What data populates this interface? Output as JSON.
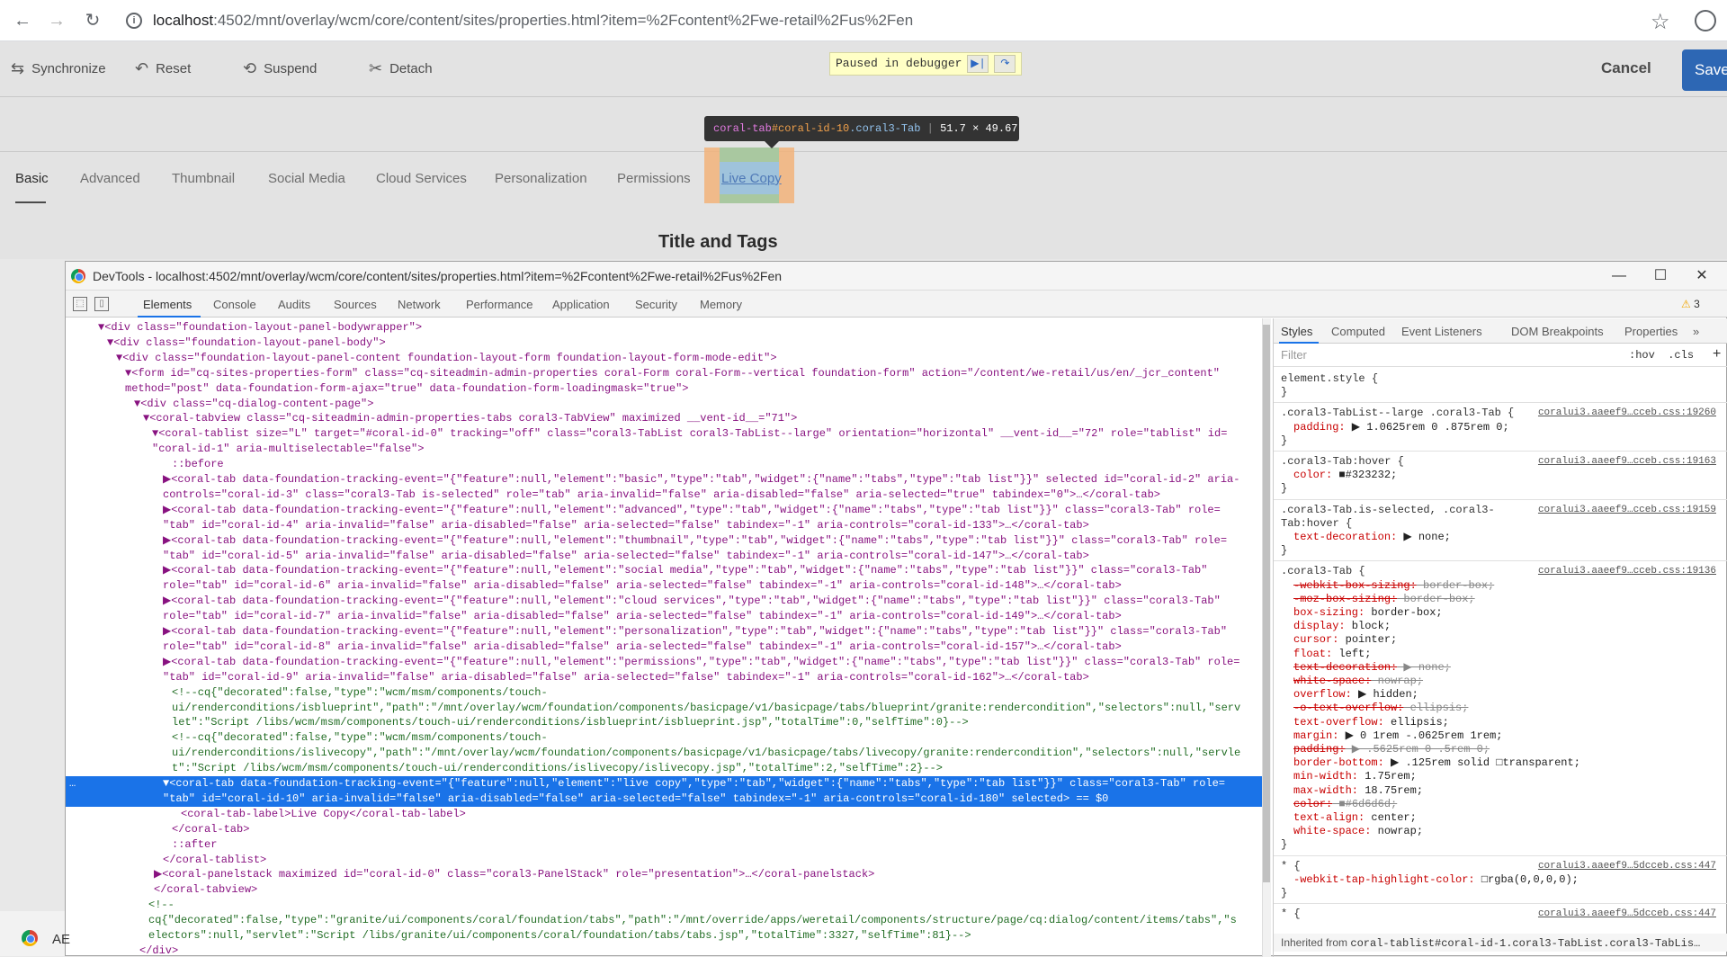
{
  "browser": {
    "url_host": "localhost",
    "url_rest": ":4502/mnt/overlay/wcm/core/content/sites/properties.html?item=%2Fcontent%2Fwe-retail%2Fus%2Fen",
    "icons": [
      "back-arrow-icon",
      "forward-arrow-icon",
      "reload-icon",
      "info-icon",
      "star-icon",
      "profile-icon"
    ]
  },
  "toolbar": {
    "synchronize": "Synchronize",
    "reset": "Reset",
    "suspend": "Suspend",
    "detach": "Detach",
    "paused": "Paused in debugger",
    "cancel": "Cancel",
    "save": "Save"
  },
  "tabs": [
    "Basic",
    "Advanced",
    "Thumbnail",
    "Social Media",
    "Cloud Services",
    "Personalization",
    "Permissions",
    "Live Copy"
  ],
  "tooltip": {
    "tag": "coral-tab",
    "id": "#coral-id-10",
    "cls": ".coral3-Tab",
    "size": "51.7 × 49.67"
  },
  "section_title": "Title and Tags",
  "devtools": {
    "title": "DevTools - localhost:4502/mnt/overlay/wcm/core/content/sites/properties.html?item=%2Fcontent%2Fwe-retail%2Fus%2Fen",
    "tabs": [
      "Elements",
      "Console",
      "Audits",
      "Sources",
      "Network",
      "Performance",
      "Application",
      "Security",
      "Memory"
    ],
    "warnings": "3",
    "window_controls": [
      "minimize",
      "maximize",
      "close"
    ]
  },
  "elements_lines": [
    "▼<div class=\"foundation-layout-panel-bodywrapper\">",
    "▼<div class=\"foundation-layout-panel-body\">",
    "▼<div class=\"foundation-layout-panel-content foundation-layout-form foundation-layout-form-mode-edit\">",
    "▼<form id=\"cq-sites-properties-form\" class=\"cq-siteadmin-admin-properties coral-Form coral-Form--vertical foundation-form\" action=\"/content/we-retail/us/en/_jcr_content\"",
    "method=\"post\" data-foundation-form-ajax=\"true\" data-foundation-form-loadingmask=\"true\">",
    "▼<div class=\"cq-dialog-content-page\">",
    "▼<coral-tabview class=\"cq-siteadmin-admin-properties-tabs coral3-TabView\" maximized __vent-id__=\"71\">",
    "▼<coral-tablist size=\"L\" target=\"#coral-id-0\" tracking=\"off\" class=\"coral3-TabList coral3-TabList--large\" orientation=\"horizontal\" __vent-id__=\"72\" role=\"tablist\" id=",
    "\"coral-id-1\" aria-multiselectable=\"false\">",
    "::before",
    "▶<coral-tab data-foundation-tracking-event=\"{\"feature\":null,\"element\":\"basic\",\"type\":\"tab\",\"widget\":{\"name\":\"tabs\",\"type\":\"tab list\"}}\" selected id=\"coral-id-2\" aria-",
    "controls=\"coral-id-3\" class=\"coral3-Tab is-selected\" role=\"tab\" aria-invalid=\"false\" aria-disabled=\"false\" aria-selected=\"true\" tabindex=\"0\">…</coral-tab>",
    "▶<coral-tab data-foundation-tracking-event=\"{\"feature\":null,\"element\":\"advanced\",\"type\":\"tab\",\"widget\":{\"name\":\"tabs\",\"type\":\"tab list\"}}\" class=\"coral3-Tab\" role=",
    "\"tab\" id=\"coral-id-4\" aria-invalid=\"false\" aria-disabled=\"false\" aria-selected=\"false\" tabindex=\"-1\" aria-controls=\"coral-id-133\">…</coral-tab>",
    "▶<coral-tab data-foundation-tracking-event=\"{\"feature\":null,\"element\":\"thumbnail\",\"type\":\"tab\",\"widget\":{\"name\":\"tabs\",\"type\":\"tab list\"}}\" class=\"coral3-Tab\" role=",
    "\"tab\" id=\"coral-id-5\" aria-invalid=\"false\" aria-disabled=\"false\" aria-selected=\"false\" tabindex=\"-1\" aria-controls=\"coral-id-147\">…</coral-tab>",
    "▶<coral-tab data-foundation-tracking-event=\"{\"feature\":null,\"element\":\"social media\",\"type\":\"tab\",\"widget\":{\"name\":\"tabs\",\"type\":\"tab list\"}}\" class=\"coral3-Tab\"",
    "role=\"tab\" id=\"coral-id-6\" aria-invalid=\"false\" aria-disabled=\"false\" aria-selected=\"false\" tabindex=\"-1\" aria-controls=\"coral-id-148\">…</coral-tab>",
    "▶<coral-tab data-foundation-tracking-event=\"{\"feature\":null,\"element\":\"cloud services\",\"type\":\"tab\",\"widget\":{\"name\":\"tabs\",\"type\":\"tab list\"}}\" class=\"coral3-Tab\"",
    "role=\"tab\" id=\"coral-id-7\" aria-invalid=\"false\" aria-disabled=\"false\" aria-selected=\"false\" tabindex=\"-1\" aria-controls=\"coral-id-149\">…</coral-tab>",
    "▶<coral-tab data-foundation-tracking-event=\"{\"feature\":null,\"element\":\"personalization\",\"type\":\"tab\",\"widget\":{\"name\":\"tabs\",\"type\":\"tab list\"}}\" class=\"coral3-Tab\"",
    "role=\"tab\" id=\"coral-id-8\" aria-invalid=\"false\" aria-disabled=\"false\" aria-selected=\"false\" tabindex=\"-1\" aria-controls=\"coral-id-157\">…</coral-tab>",
    "▶<coral-tab data-foundation-tracking-event=\"{\"feature\":null,\"element\":\"permissions\",\"type\":\"tab\",\"widget\":{\"name\":\"tabs\",\"type\":\"tab list\"}}\" class=\"coral3-Tab\" role=",
    "\"tab\" id=\"coral-id-9\" aria-invalid=\"false\" aria-disabled=\"false\" aria-selected=\"false\" tabindex=\"-1\" aria-controls=\"coral-id-162\">…</coral-tab>",
    "<!--cq{\"decorated\":false,\"type\":\"wcm/msm/components/touch-",
    "ui/renderconditions/isblueprint\",\"path\":\"/mnt/overlay/wcm/foundation/components/basicpage/v1/basicpage/tabs/blueprint/granite:rendercondition\",\"selectors\":null,\"serv",
    "let\":\"Script /libs/wcm/msm/components/touch-ui/renderconditions/isblueprint/isblueprint.jsp\",\"totalTime\":0,\"selfTime\":0}-->",
    "<!--cq{\"decorated\":false,\"type\":\"wcm/msm/components/touch-",
    "ui/renderconditions/islivecopy\",\"path\":\"/mnt/overlay/wcm/foundation/components/basicpage/v1/basicpage/tabs/livecopy/granite:rendercondition\",\"selectors\":null,\"servle",
    "t\":\"Script /libs/wcm/msm/components/touch-ui/renderconditions/islivecopy/islivecopy.jsp\",\"totalTime\":2,\"selfTime\":2}-->",
    "▼<coral-tab data-foundation-tracking-event=\"{\"feature\":null,\"element\":\"live copy\",\"type\":\"tab\",\"widget\":{\"name\":\"tabs\",\"type\":\"tab list\"}}\" class=\"coral3-Tab\" role=",
    "\"tab\" id=\"coral-id-10\" aria-invalid=\"false\" aria-disabled=\"false\" aria-selected=\"false\" tabindex=\"-1\" aria-controls=\"coral-id-180\" selected> == $0",
    "<coral-tab-label>Live Copy</coral-tab-label>",
    "</coral-tab>",
    "::after",
    "</coral-tablist>",
    "▶<coral-panelstack maximized id=\"coral-id-0\" class=\"coral3-PanelStack\" role=\"presentation\">…</coral-panelstack>",
    "</coral-tabview>",
    "<!--",
    "cq{\"decorated\":false,\"type\":\"granite/ui/components/coral/foundation/tabs\",\"path\":\"/mnt/override/apps/weretail/components/structure/page/cq:dialog/content/items/tabs\",\"s",
    "electors\":null,\"servlet\":\"Script /libs/granite/ui/components/coral/foundation/tabs/tabs.jsp\",\"totalTime\":3327,\"selfTime\":81}-->",
    "</div>"
  ],
  "styles": {
    "tabs": [
      "Styles",
      "Computed",
      "Event Listeners",
      "DOM Breakpoints",
      "Properties"
    ],
    "filter_placeholder": "Filter",
    "hov": ":hov",
    "cls": ".cls",
    "inherited_label": "Inherited from",
    "inherited_node": "coral-tablist#coral-id-1.coral3-TabList.coral3-TabLis…"
  },
  "styles_lines": [
    {
      "t": "element.style {",
      "k": "sel"
    },
    {
      "t": "}",
      "k": "sel"
    },
    {
      "t": ".coral3-TabList--large .coral3-Tab {",
      "k": "sel",
      "src": "coralui3.aaeef9…cceb.css:19260"
    },
    {
      "t": "padding: ▶ 1.0625rem 0 .875rem 0;",
      "k": "prop"
    },
    {
      "t": "}",
      "k": "sel"
    },
    {
      "t": ".coral3-Tab:hover {",
      "k": "sel",
      "src": "coralui3.aaeef9…cceb.css:19163"
    },
    {
      "t": "color: ■#323232;",
      "k": "prop"
    },
    {
      "t": "}",
      "k": "sel"
    },
    {
      "t": ".coral3-Tab.is-selected, .coral3-",
      "k": "sel",
      "src": "coralui3.aaeef9…cceb.css:19159"
    },
    {
      "t": "Tab:hover {",
      "k": "sel"
    },
    {
      "t": "text-decoration: ▶ none;",
      "k": "prop"
    },
    {
      "t": "}",
      "k": "sel"
    },
    {
      "t": ".coral3-Tab {",
      "k": "sel",
      "src": "coralui3.aaeef9…cceb.css:19136"
    },
    {
      "t": "-webkit-box-sizing: border-box;",
      "k": "struck"
    },
    {
      "t": "-moz-box-sizing: border-box;",
      "k": "struck"
    },
    {
      "t": "box-sizing: border-box;",
      "k": "prop"
    },
    {
      "t": "display: block;",
      "k": "prop"
    },
    {
      "t": "cursor: pointer;",
      "k": "prop"
    },
    {
      "t": "float: left;",
      "k": "prop"
    },
    {
      "t": "text-decoration: ▶ none;",
      "k": "struck"
    },
    {
      "t": "white-space: nowrap;",
      "k": "struck"
    },
    {
      "t": "overflow: ▶ hidden;",
      "k": "prop"
    },
    {
      "t": "-o-text-overflow: ellipsis;",
      "k": "struck"
    },
    {
      "t": "text-overflow: ellipsis;",
      "k": "prop"
    },
    {
      "t": "margin: ▶ 0 1rem -.0625rem 1rem;",
      "k": "prop"
    },
    {
      "t": "padding: ▶ .5625rem 0 .5rem 0;",
      "k": "struck"
    },
    {
      "t": "border-bottom: ▶ .125rem solid □transparent;",
      "k": "prop"
    },
    {
      "t": "min-width: 1.75rem;",
      "k": "prop"
    },
    {
      "t": "max-width: 18.75rem;",
      "k": "prop"
    },
    {
      "t": "color: ■#6d6d6d;",
      "k": "struck"
    },
    {
      "t": "text-align: center;",
      "k": "prop"
    },
    {
      "t": "white-space: nowrap;",
      "k": "prop"
    },
    {
      "t": "}",
      "k": "sel"
    },
    {
      "t": "* {",
      "k": "sel",
      "src": "coralui3.aaeef9…5dcceb.css:447"
    },
    {
      "t": "-webkit-tap-highlight-color: □rgba(0,0,0,0);",
      "k": "prop"
    },
    {
      "t": "}",
      "k": "sel"
    },
    {
      "t": "* {",
      "k": "sel",
      "src": "coralui3.aaeef9…5dcceb.css:447"
    }
  ],
  "taskbar": {
    "app_text": "AE"
  }
}
